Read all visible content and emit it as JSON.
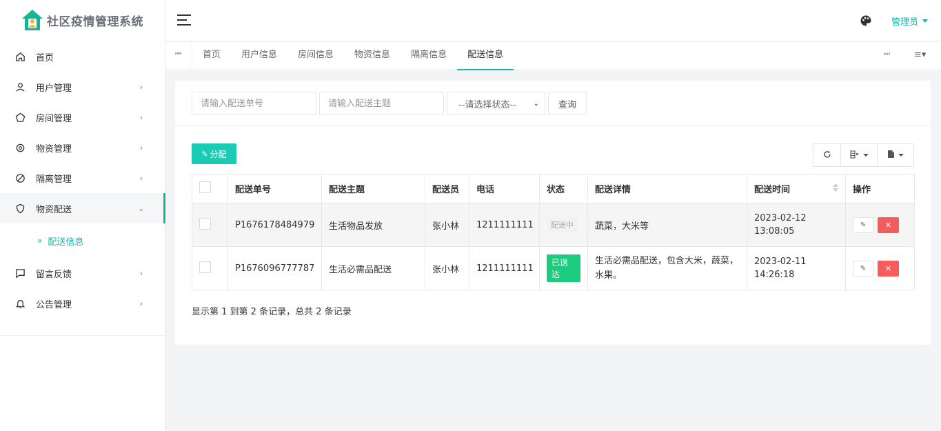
{
  "app": {
    "title": "社区疫情管理系统"
  },
  "sidebar": {
    "items": [
      {
        "label": "首页",
        "icon": "home-icon",
        "arrow": ""
      },
      {
        "label": "用户管理",
        "icon": "user-icon",
        "arrow": "›"
      },
      {
        "label": "房间管理",
        "icon": "pentagon-icon",
        "arrow": "›"
      },
      {
        "label": "物资管理",
        "icon": "gear-icon",
        "arrow": "›"
      },
      {
        "label": "隔离管理",
        "icon": "ban-icon",
        "arrow": "›"
      },
      {
        "label": "物资配送",
        "icon": "shield-icon",
        "arrow": "⌄"
      },
      {
        "label": "留言反馈",
        "icon": "message-icon",
        "arrow": "›"
      },
      {
        "label": "公告管理",
        "icon": "bell-icon",
        "arrow": "›"
      }
    ],
    "subitem": {
      "chevron": "»",
      "label": "配送信息"
    }
  },
  "header": {
    "user": "管理员"
  },
  "tabs": {
    "items": [
      "首页",
      "用户信息",
      "房间信息",
      "物资信息",
      "隔离信息",
      "配送信息"
    ],
    "active_index": 5
  },
  "search": {
    "order_placeholder": "请输入配送单号",
    "topic_placeholder": "请输入配送主题",
    "status_select": "--请选择状态--",
    "query_label": "查询"
  },
  "actions": {
    "assign_label": "分配"
  },
  "table": {
    "headers": [
      "配送单号",
      "配送主题",
      "配送员",
      "电话",
      "状态",
      "配送详情",
      "配送时间",
      "操作"
    ],
    "rows": [
      {
        "order_no": "P1676178484979",
        "topic": "生活物品发放",
        "courier": "张小林",
        "phone": "1211111111",
        "status": "配送中",
        "detail": "蔬菜，大米等",
        "time_date": "2023-02-12",
        "time_clock": "13:08:05"
      },
      {
        "order_no": "P1676096777787",
        "topic": "生活必需品配送",
        "courier": "张小林",
        "phone": "1211111111",
        "status": "已送达",
        "detail": "生活必需品配送，包含大米，蔬菜，水果。",
        "time_date": "2023-02-11",
        "time_clock": "14:26:18"
      }
    ]
  },
  "pagination": {
    "summary": "显示第 1 到第 2 条记录，总共 2 条记录"
  },
  "colors": {
    "accent": "#19b6a6",
    "primary_button": "#1ccbb4",
    "danger": "#f55d5d",
    "success": "#1ccb7e"
  }
}
